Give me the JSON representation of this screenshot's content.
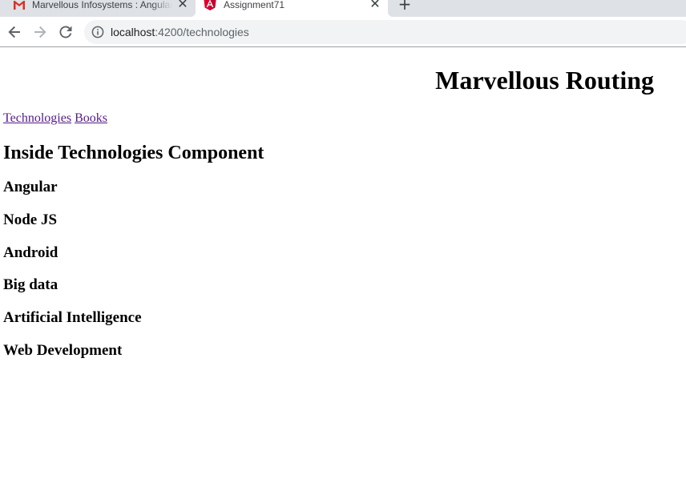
{
  "browser": {
    "tabs": [
      {
        "title": "Marvellous Infosystems : Angular",
        "icon": "gmail-icon",
        "active": false
      },
      {
        "title": "Assignment71",
        "icon": "angular-icon",
        "active": true
      }
    ],
    "new_tab_symbol": "+",
    "close_symbol": "✕",
    "url_host": "localhost",
    "url_path": ":4200/technologies"
  },
  "page": {
    "title": "Marvellous Routing",
    "nav_links": [
      {
        "label": "Technologies"
      },
      {
        "label": "Books"
      }
    ],
    "section_heading": "Inside Technologies Component",
    "technologies": [
      "Angular",
      "Node JS",
      "Android",
      "Big data",
      "Artificial Intelligence",
      "Web Development"
    ]
  },
  "colors": {
    "tabstrip": "#dee1e6",
    "omnibox": "#f1f3f4",
    "visited_link": "#551a8b",
    "angular_red": "#dd0031"
  }
}
